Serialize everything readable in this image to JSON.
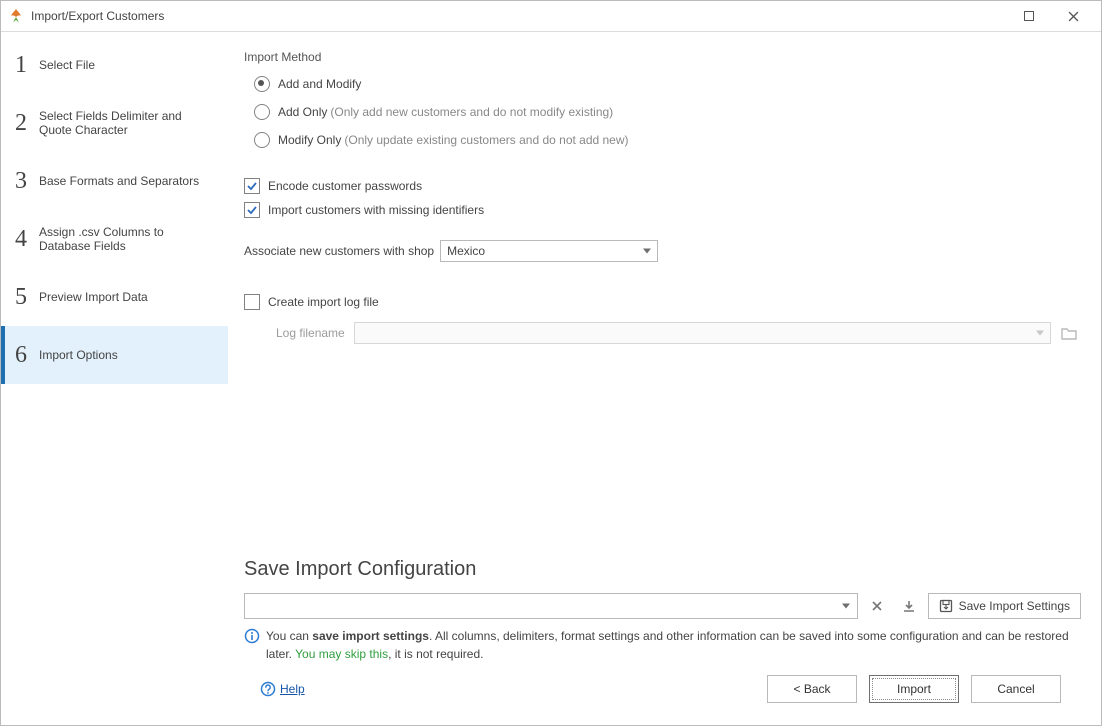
{
  "window": {
    "title": "Import/Export Customers"
  },
  "sidebar": {
    "steps": [
      {
        "num": "1",
        "label": "Select File"
      },
      {
        "num": "2",
        "label": "Select Fields Delimiter and Quote Character"
      },
      {
        "num": "3",
        "label": "Base Formats and Separators"
      },
      {
        "num": "4",
        "label": "Assign .csv Columns to Database Fields"
      },
      {
        "num": "5",
        "label": "Preview Import Data"
      },
      {
        "num": "6",
        "label": "Import Options"
      }
    ],
    "active_index": 5
  },
  "import_method": {
    "group_label": "Import Method",
    "options": [
      {
        "label": "Add and Modify",
        "hint": "",
        "checked": true
      },
      {
        "label": "Add Only",
        "hint": "(Only add new customers and do not modify existing)",
        "checked": false
      },
      {
        "label": "Modify Only",
        "hint": "(Only update existing customers and do not add new)",
        "checked": false
      }
    ]
  },
  "checkboxes": {
    "encode_passwords": {
      "label": "Encode customer passwords",
      "checked": true
    },
    "missing_identifiers": {
      "label": "Import customers with missing identifiers",
      "checked": true
    }
  },
  "associate": {
    "label": "Associate new customers with shop",
    "value": "Mexico"
  },
  "log": {
    "create_label": "Create import log file",
    "create_checked": false,
    "filename_label": "Log filename",
    "filename_value": ""
  },
  "save_config": {
    "header": "Save Import Configuration",
    "combo_value": "",
    "save_button": "Save Import Settings",
    "info_pre": "You can ",
    "info_bold": "save import settings",
    "info_mid": ". All columns, delimiters, format settings and other information can be saved into some configuration and can be restored later. ",
    "info_green": "You may skip this",
    "info_post": ", it is not required."
  },
  "footer": {
    "help": "Help",
    "back": "< Back",
    "import": "Import",
    "cancel": "Cancel"
  }
}
